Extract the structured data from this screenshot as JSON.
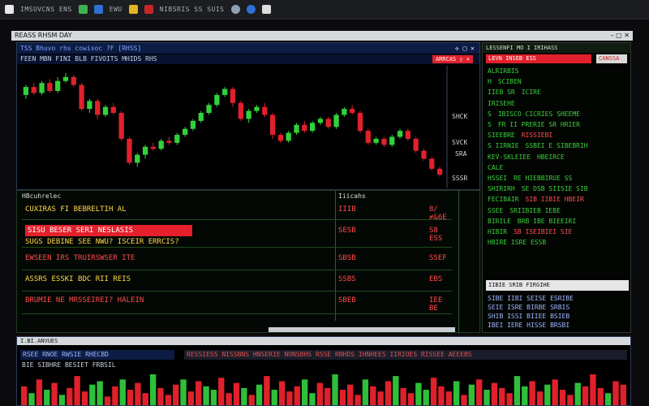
{
  "toolbar": {
    "label_1": "IMSUVCNS ENS",
    "label_2": "EWU",
    "label_3": "NIBSRIS SS SUIS",
    "icon_colors": [
      "#e8e8e8",
      "#3fb34f",
      "#2f6fd6",
      "#e3b320",
      "#c62828",
      "#8fa0b0",
      "#2f6fd6",
      "#dcdcdc"
    ]
  },
  "app": {
    "title": "REASS RHSM DAY",
    "controls": "– ▢ ✕"
  },
  "chart": {
    "title": "TSS  Bhuvo rhs cowisoc  ?F  [RHSS]",
    "controls": "✢  ▢  ✕",
    "sub": "FEEN   MBN   FINI BLB FIVOITS MHIDS RHS",
    "badge": "ARRCAS  ▯ ✕",
    "right_labels": [
      "SHCK",
      "SVCK",
      "SRA",
      "SSSR"
    ]
  },
  "chart_data": {
    "type": "candlestick",
    "candles": [
      [
        52,
        56,
        50,
        57
      ],
      [
        56,
        53,
        52,
        58
      ],
      [
        53,
        58,
        52,
        59
      ],
      [
        58,
        54,
        53,
        60
      ],
      [
        54,
        59,
        53,
        61
      ],
      [
        59,
        61,
        58,
        63
      ],
      [
        61,
        57,
        56,
        62
      ],
      [
        57,
        45,
        44,
        58
      ],
      [
        45,
        49,
        43,
        50
      ],
      [
        49,
        42,
        40,
        50
      ],
      [
        42,
        46,
        41,
        47
      ],
      [
        46,
        43,
        42,
        48
      ],
      [
        43,
        30,
        29,
        44
      ],
      [
        30,
        18,
        17,
        31
      ],
      [
        18,
        22,
        16,
        23
      ],
      [
        22,
        26,
        20,
        27
      ],
      [
        26,
        25,
        24,
        28
      ],
      [
        25,
        29,
        24,
        30
      ],
      [
        29,
        28,
        27,
        31
      ],
      [
        28,
        32,
        27,
        33
      ],
      [
        32,
        35,
        31,
        36
      ],
      [
        35,
        39,
        34,
        40
      ],
      [
        39,
        43,
        38,
        44
      ],
      [
        43,
        47,
        42,
        48
      ],
      [
        47,
        52,
        46,
        53
      ],
      [
        52,
        55,
        51,
        56
      ],
      [
        55,
        48,
        46,
        56
      ],
      [
        48,
        40,
        39,
        49
      ],
      [
        40,
        44,
        38,
        45
      ],
      [
        44,
        46,
        43,
        47
      ],
      [
        46,
        42,
        41,
        48
      ],
      [
        42,
        32,
        30,
        43
      ],
      [
        32,
        29,
        28,
        33
      ],
      [
        29,
        33,
        28,
        34
      ],
      [
        33,
        37,
        32,
        38
      ],
      [
        37,
        34,
        33,
        39
      ],
      [
        34,
        38,
        33,
        39
      ],
      [
        38,
        40,
        37,
        41
      ],
      [
        40,
        36,
        35,
        41
      ],
      [
        36,
        42,
        35,
        43
      ],
      [
        42,
        45,
        41,
        46
      ],
      [
        45,
        43,
        42,
        47
      ],
      [
        43,
        34,
        33,
        44
      ],
      [
        34,
        28,
        27,
        35
      ],
      [
        28,
        30,
        27,
        31
      ],
      [
        30,
        27,
        26,
        31
      ],
      [
        27,
        31,
        26,
        32
      ],
      [
        31,
        34,
        30,
        35
      ],
      [
        34,
        30,
        29,
        35
      ],
      [
        30,
        24,
        23,
        31
      ],
      [
        24,
        20,
        19,
        25
      ],
      [
        20,
        15,
        14,
        21
      ],
      [
        15,
        12,
        11,
        16
      ]
    ]
  },
  "mid": {
    "head_left": "HBcuhrelec",
    "head_right": "Iiicahs",
    "rows": [
      {
        "name": "CUXIRAS FI BEBRELTIH  AL",
        "val": "IIIB",
        "chg": "8/ ≠&6E"
      },
      {
        "name": "SUGS DEBINE SEE NWU?  ISCEIR ERRCIS?",
        "val": "SESB",
        "chg": "S8 ESS",
        "highlight": "SISU BESER SERI NESLASIS"
      },
      {
        "name": "EWSEEN  IRS TRUIRSWSER ITE",
        "val": "SBSB",
        "chg": "SSEF"
      },
      {
        "name": "ASSRS ESSKI BDC RII REIS",
        "val": "SSBS",
        "chg": "EBS"
      },
      {
        "name": "BRUMIE NE MRSSEIREI? HALEIN",
        "val": "SBEB",
        "chg": "IEE BE"
      }
    ]
  },
  "right": {
    "title": "LESSENFI MO I IRIHASS",
    "tab": "LEVN INSEB ESS",
    "tab2": "CANSSA",
    "lines": [
      {
        "a": "ALRIRBIS",
        "b": ""
      },
      {
        "a": "H",
        "b": "SCIBEN"
      },
      {
        "a": "IIEB  SR",
        "b": "ICIRE"
      },
      {
        "a": "IRISEHE",
        "b": ""
      },
      {
        "a": "S",
        "b": "IBISCO CICRIES SHEEME"
      },
      {
        "a": "S",
        "b": "FR II PRERIE  SR HRIER"
      },
      {
        "a": "SIEEBRE",
        "b": "RISSIEBI"
      },
      {
        "a": "S IIRNIE",
        "b": "SSBEI  E SIBEBRIH"
      },
      {
        "a": "KEV-SKLEIEE",
        "b": "HBEIRCE"
      },
      {
        "a": "CALE",
        "b": ""
      },
      {
        "a": "HSSEI",
        "b": "RE HIEBBIRUE SS"
      },
      {
        "a": "SHIRIRH",
        "b": "SE DSB SIISIE SIB"
      },
      {
        "a": "FECIBAIR",
        "b": "SIB IIBIE HBEIR"
      },
      {
        "a": "SSEE",
        "b": "SRIIBIEB IEBE"
      },
      {
        "a": "BIRILE",
        "b": "BRB IBE BIEEIRI"
      },
      {
        "a": "HIBIR",
        "b": "SB ISEIBIEI SIE"
      },
      {
        "a": "HBIRE ISRE ESSB",
        "b": ""
      }
    ],
    "bar": "IIBIE SRIB  FIRGIHE",
    "bottom_lines": [
      "SIBE  IIBI  SEISE  ESRIBE",
      "SEIE  ISRE  BIRBE  SRBIS",
      "SHIB  ISSI  BIIEE  BSIEB",
      "IBEI  IERE  HISSE  BRSBI"
    ]
  },
  "bottom": {
    "title": "I.BI.ANVUES",
    "row1": "RSEE  RNOE RWSIE RHECBD",
    "row1b": "RESSIESS NISSBNS HNSERIE NONSBHS RSSE RNHDS IHNHEES IIRIOES RISSEE AEEEBS",
    "row2": "BIE SIBHRE BESIET  FRBSIL",
    "volumes": [
      22,
      14,
      30,
      18,
      26,
      12,
      20,
      34,
      16,
      24,
      28,
      10,
      22,
      30,
      18,
      26,
      14,
      36,
      20,
      12,
      24,
      30,
      16,
      28,
      22,
      18,
      32,
      14,
      26,
      20,
      12,
      24,
      34,
      18,
      28,
      16,
      22,
      30,
      14,
      26,
      20,
      36,
      18,
      24,
      12,
      30,
      22,
      16,
      28,
      34,
      20,
      14,
      26,
      18,
      32,
      22,
      16,
      28,
      12,
      24,
      30,
      18,
      26,
      20,
      14,
      34,
      22,
      28,
      16,
      24,
      30,
      18,
      12,
      26,
      22,
      36,
      20,
      14,
      28,
      24
    ],
    "vol_colors": [
      "#e0212b",
      "#2fbf3a"
    ]
  }
}
